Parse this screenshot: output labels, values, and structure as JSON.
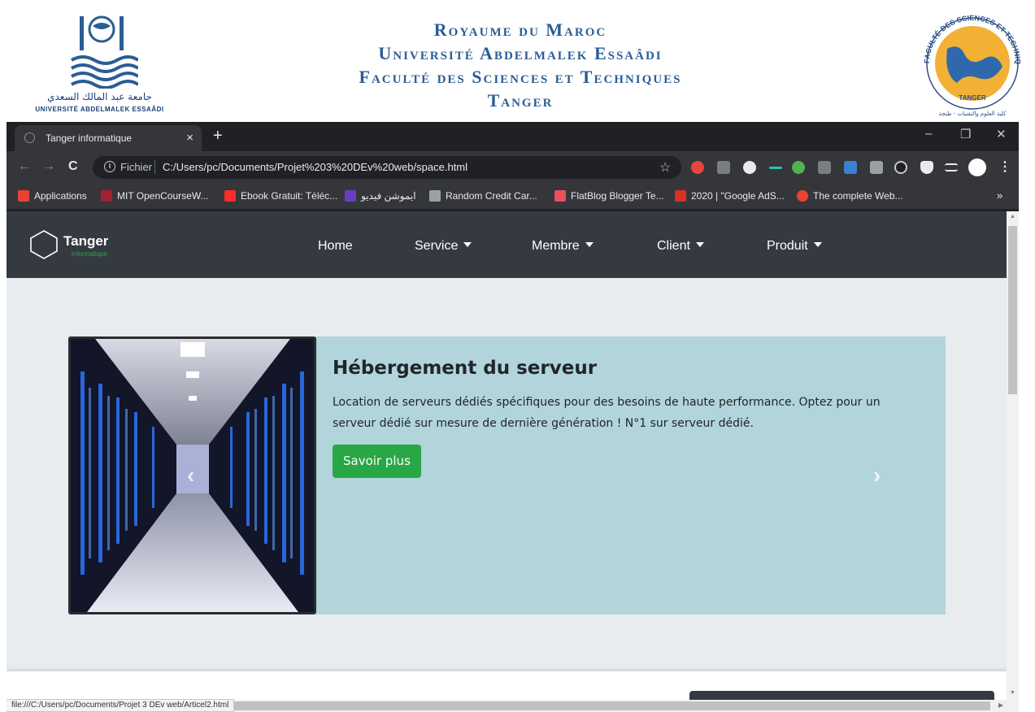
{
  "university": {
    "logo_left_arabic": "جامعة عبد المالك السعدي",
    "logo_left_latin": "UNIVERSITÉ ABDELMALEK ESSAÂDI",
    "title_lines": [
      "Royaume du Maroc",
      "Université Abdelmalek Essaâdi",
      "Faculté des Sciences et Techniques",
      "Tanger"
    ],
    "logo_right_ring": "FACULTÉ DES SCIENCES ET TECHNIQUES",
    "logo_right_city": "TANGER",
    "logo_right_arabic": "كلية العلوم والتقنيات - طنجة"
  },
  "browser": {
    "tab_title": "Tanger informatique",
    "tab_close": "×",
    "new_tab": "+",
    "win_minimize": "–",
    "win_restore": "❐",
    "win_close": "✕",
    "nav_back": "←",
    "nav_forward": "→",
    "nav_reload": "C",
    "url_scheme": "Fichier",
    "url": "C:/Users/pc/Documents/Projet%203%20DEv%20web/space.html",
    "bookmark_star": "☆",
    "more_menu": "⋮",
    "bookmarks": [
      {
        "label": "Applications",
        "color": "#e94235"
      },
      {
        "label": "MIT OpenCourseW...",
        "color": "#a31f34"
      },
      {
        "label": "Ebook Gratuit: Téléc...",
        "color": "#ff2a2a"
      },
      {
        "label": "ايموشن فيديو",
        "color": "#6a3fbf"
      },
      {
        "label": "Random Credit Car...",
        "color": "#9aa0a6"
      },
      {
        "label": "FlatBlog Blogger Te...",
        "color": "#e8505b"
      },
      {
        "label": "2020 | \"Google AdS...",
        "color": "#d93025"
      },
      {
        "label": "The complete Web...",
        "color": "#ea4335"
      }
    ],
    "bookmarks_more": "»",
    "status_url": "file:///C:/Users/pc/Documents/Projet 3 DEv web/Articel2.html"
  },
  "site": {
    "brand_name": "Tanger",
    "brand_sub": "informatique",
    "nav": [
      "Home",
      "Service",
      "Membre",
      "Client",
      "Produit"
    ],
    "card": {
      "title": "Hébergement du serveur",
      "text": "Location de serveurs dédiés spécifiques pour des besoins de haute performance. Optez pour un serveur dédié sur mesure de dernière génération ! N°1 sur serveur dédié.",
      "button": "Savoir plus",
      "prev": "‹",
      "next": "›"
    }
  },
  "colors": {
    "navbar": "#343a40",
    "card_bg": "#b1d5db",
    "button": "#28a745",
    "page_bg": "#e9ecef",
    "uni_blue": "#2a5d95"
  }
}
